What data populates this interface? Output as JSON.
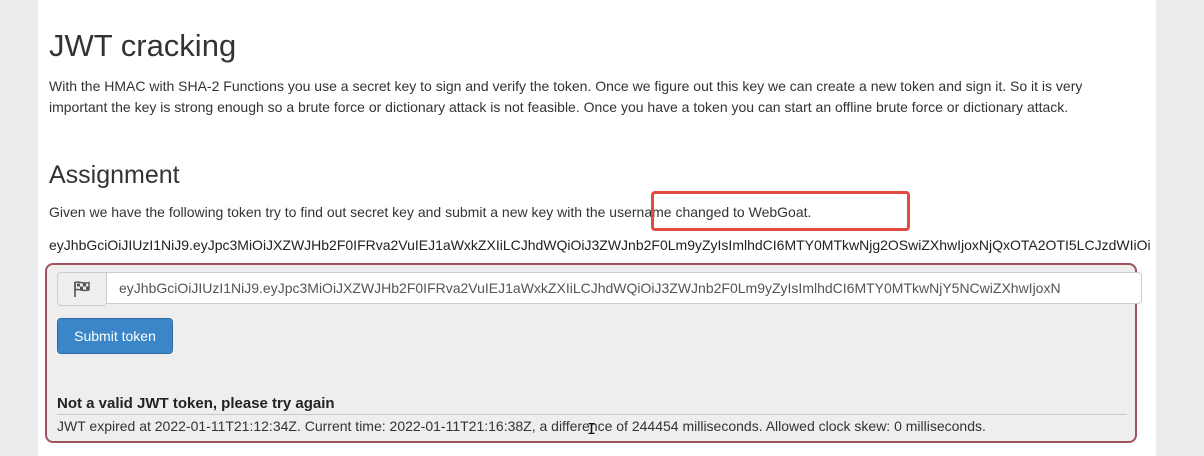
{
  "lesson": {
    "title": "JWT cracking",
    "intro": "With the HMAC with SHA-2 Functions you use a secret key to sign and verify the token. Once we figure out this key we can create a new token and sign it. So it is very important the key is strong enough so a brute force or dictionary attack is not feasible. Once you have a token you can start an offline brute force or dictionary attack."
  },
  "assignment": {
    "heading": "Assignment",
    "instruction": "Given we have the following token try to find out secret key and submit a new key with the username changed to WebGoat.",
    "token": "eyJhbGciOiJIUzI1NiJ9.eyJpc3MiOiJXZWJHb2F0IFRva2VuIEJ1aWxkZXIiLCJhdWQiOiJ3ZWJnb2F0Lm9yZyIsImlhdCI6MTY0MTkwNjg2OSwiZXhwIjoxNjQxOTA2OTI5LCJzdWIiOi"
  },
  "form": {
    "input_icon": "flag-icon",
    "input_value": "eyJhbGciOiJIUzI1NiJ9.eyJpc3MiOiJXZWJHb2F0IFRva2VuIEJ1aWxkZXIiLCJhdWQiOiJ3ZWJnb2F0Lm9yZyIsImlhdCI6MTY0MTkwNjY5NCwiZXhwIjoxN",
    "submit_label": "Submit token"
  },
  "feedback": {
    "title": "Not a valid JWT token, please try again",
    "message": "JWT expired at 2022-01-11T21:12:34Z. Current time: 2022-01-11T21:16:38Z, a difference of 244454 milliseconds. Allowed clock skew: 0 milliseconds."
  },
  "colors": {
    "highlight": "#e04a3f",
    "form_border": "#a0525e",
    "button": "#3a86c8"
  }
}
